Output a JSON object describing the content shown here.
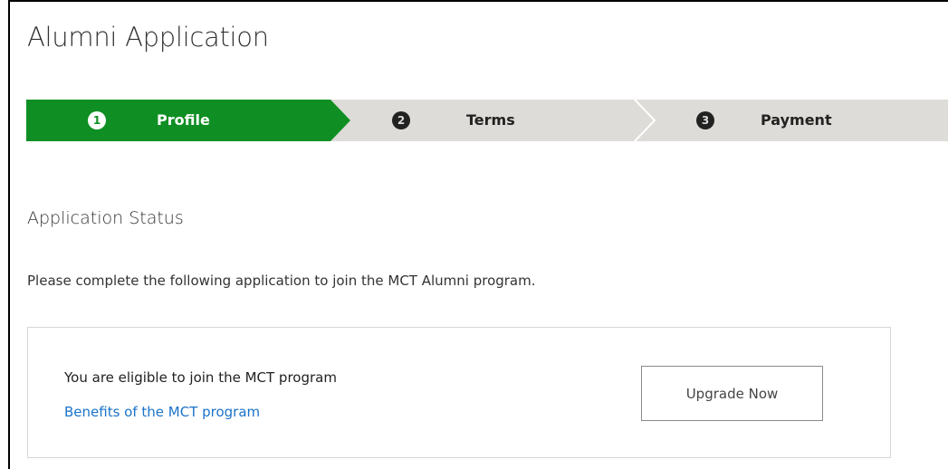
{
  "page": {
    "title": "Alumni Application"
  },
  "wizard": {
    "steps": [
      {
        "number": "1",
        "label": "Profile",
        "state": "active"
      },
      {
        "number": "2",
        "label": "Terms",
        "state": "inactive"
      },
      {
        "number": "3",
        "label": "Payment",
        "state": "inactive"
      }
    ]
  },
  "status": {
    "heading": "Application Status",
    "intro": "Please complete the following application to join the MCT Alumni program."
  },
  "eligibility": {
    "message": "You are eligible to join the MCT program",
    "benefits_link": "Benefits of the MCT program",
    "upgrade_button": "Upgrade Now"
  },
  "colors": {
    "active_step": "#0f8f23",
    "inactive_step": "#dedcd8",
    "link": "#1a73c9",
    "panel_border": "#d6d6d6"
  }
}
